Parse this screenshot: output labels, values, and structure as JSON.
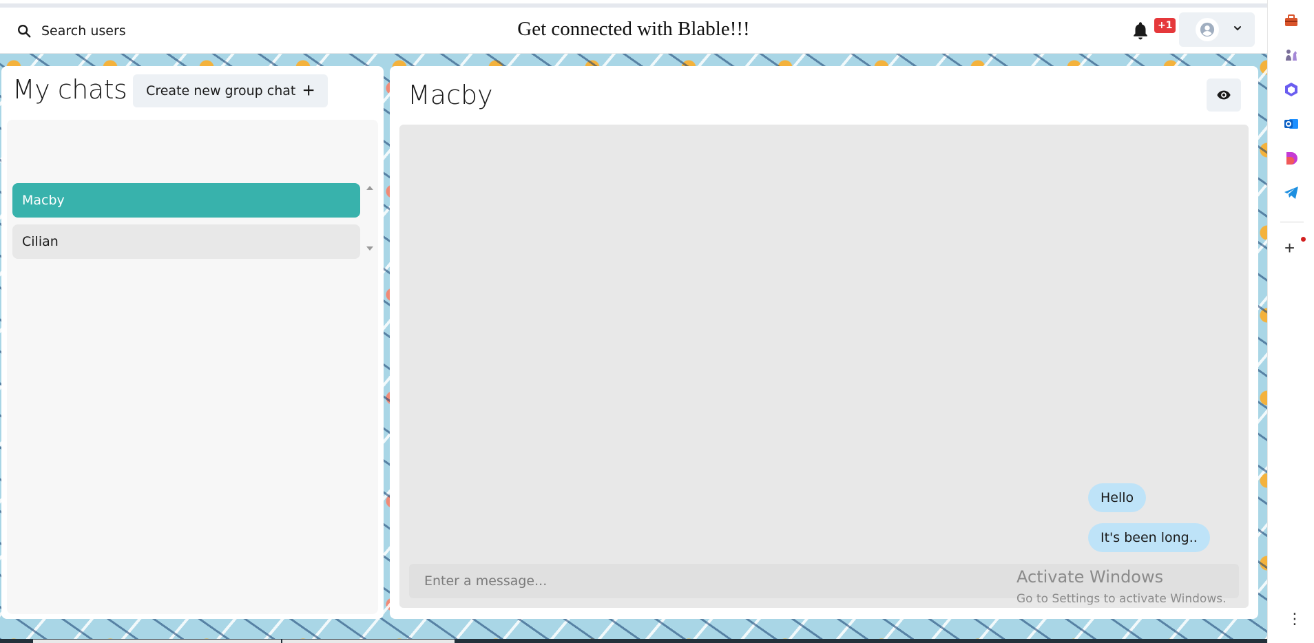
{
  "header": {
    "search_label": "Search users",
    "app_title": "Get connected with Blable!!!",
    "notification_badge": "+1"
  },
  "left_panel": {
    "title": "My chats",
    "new_group_label": "Create new group chat",
    "chats": [
      {
        "name": "Macby",
        "active": true
      },
      {
        "name": "Cilian",
        "active": false
      }
    ]
  },
  "chat": {
    "title": "Macby",
    "messages": [
      {
        "text": "Hello"
      },
      {
        "text": "It's been long.."
      }
    ],
    "input_placeholder": "Enter a message..."
  },
  "watermark": {
    "line1": "Activate Windows",
    "line2": "Go to Settings to activate Windows."
  },
  "browser_sidebar": {
    "icons": [
      "briefcase-icon",
      "chess-icon",
      "copilot-icon",
      "outlook-icon",
      "designer-icon",
      "telegram-icon"
    ]
  },
  "colors": {
    "accent": "#38b2ac",
    "bubble": "#bee3f8",
    "badge": "#e5383b"
  }
}
